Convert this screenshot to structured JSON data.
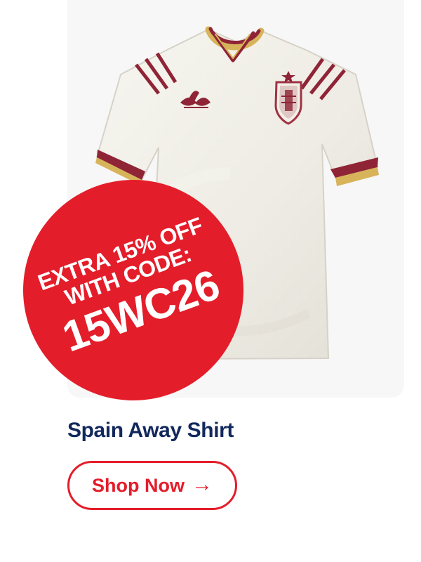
{
  "promotion": {
    "line_1": "EXTRA 15% OFF",
    "line_2": "WITH CODE:",
    "code": "15WC26"
  },
  "product": {
    "name": "Spain Away Shirt",
    "image_label": "Spain Away Shirt image"
  },
  "cta": {
    "label": "Shop Now",
    "icon": "arrow-right-icon",
    "symbol": "→"
  },
  "colors": {
    "background": "#ffffff",
    "card_background": "#f7f7f7",
    "shirt_base": "#efede6",
    "shirt_trim": "#8f2436",
    "shirt_gold": "#d7b45a",
    "promo_red": "#e41d2a",
    "title_navy": "#12285d"
  }
}
